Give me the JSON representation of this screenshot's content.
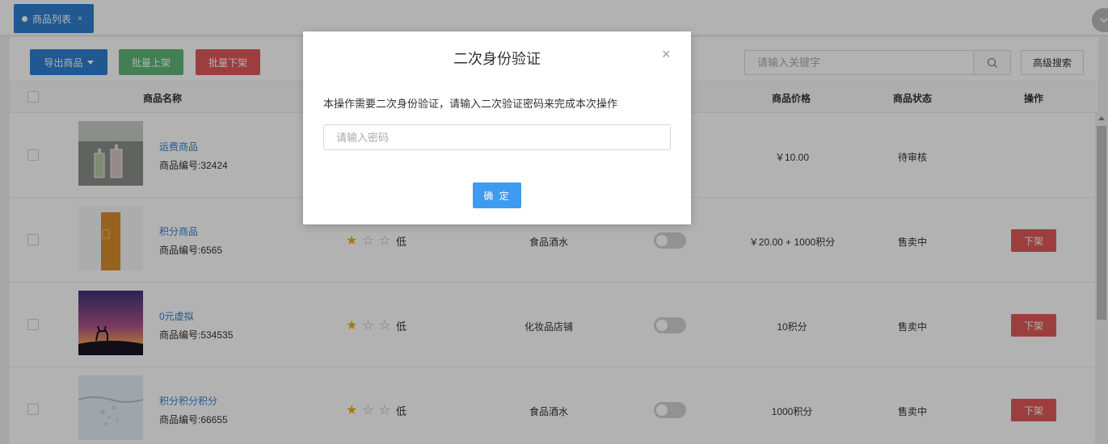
{
  "tabs": [
    {
      "label": "商品列表",
      "close": "×"
    }
  ],
  "tab_toggle_icon": "chevron-down-icon",
  "toolbar": {
    "export_label": "导出商品",
    "batch_on_label": "批量上架",
    "batch_off_label": "批量下架",
    "search_placeholder": "请输入关键字",
    "advanced_search_label": "高级搜索"
  },
  "table": {
    "headers": {
      "name": "商品名称",
      "price": "商品价格",
      "status": "商品状态",
      "action": "操作"
    },
    "rows": [
      {
        "name": "运费商品",
        "code": "商品编号:32424",
        "price": "￥10.00",
        "status": "待审核",
        "image": "perfume-bottles-photo"
      },
      {
        "name": "积分商品",
        "code": "商品编号:6565",
        "level": "低",
        "store": "食品酒水",
        "price": "￥20.00 + 1000积分",
        "status": "售卖中",
        "action": "下架",
        "image": "orange-box-photo"
      },
      {
        "name": "0元虚拟",
        "code": "商品编号:534535",
        "level": "低",
        "store": "化妆品店铺",
        "price": "10积分",
        "status": "售卖中",
        "action": "下架",
        "image": "deer-sunset-photo"
      },
      {
        "name": "积分积分积分",
        "code": "商品编号:66655",
        "level": "低",
        "store": "食品酒水",
        "price": "1000积分",
        "status": "售卖中",
        "action": "下架",
        "image": "water-splash-photo"
      }
    ]
  },
  "modal": {
    "title": "二次身份验证",
    "close": "×",
    "message": "本操作需要二次身份验证，请输入二次验证密码来完成本次操作",
    "password_placeholder": "请输入密码",
    "confirm_label": "确 定"
  },
  "colors": {
    "primary": "#2f7fd1",
    "success": "#5fb878",
    "danger": "#e05a5a",
    "confirm": "#3e9bf0",
    "star": "#e8b00f"
  }
}
